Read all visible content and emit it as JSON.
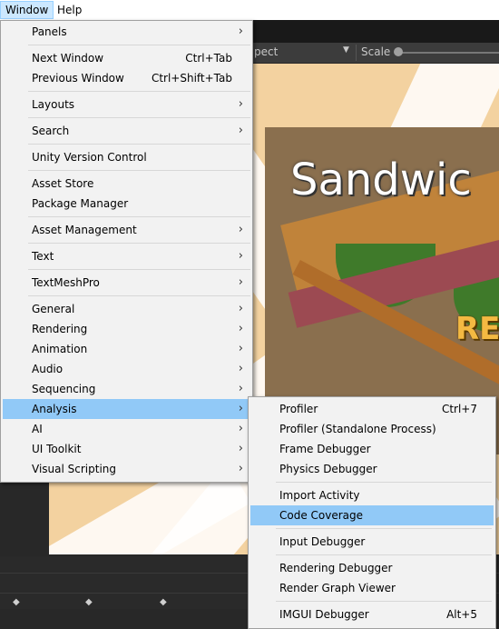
{
  "menubar": {
    "window": "Window",
    "help": "Help"
  },
  "toolbar": {
    "aspect": "pect",
    "scale": "Scale",
    "dropdown_arrow": "▼"
  },
  "game": {
    "title": "Sandwic",
    "badge": "RE"
  },
  "window_menu": [
    {
      "label": "Panels",
      "shortcut": "",
      "submenu": true
    },
    {
      "label": "Next Window",
      "shortcut": "Ctrl+Tab",
      "submenu": false
    },
    {
      "label": "Previous Window",
      "shortcut": "Ctrl+Shift+Tab",
      "submenu": false
    },
    {
      "label": "Layouts",
      "shortcut": "",
      "submenu": true
    },
    {
      "label": "Search",
      "shortcut": "",
      "submenu": true
    },
    {
      "label": "Unity Version Control",
      "shortcut": "",
      "submenu": false
    },
    {
      "label": "Asset Store",
      "shortcut": "",
      "submenu": false
    },
    {
      "label": "Package Manager",
      "shortcut": "",
      "submenu": false
    },
    {
      "label": "Asset Management",
      "shortcut": "",
      "submenu": true
    },
    {
      "label": "Text",
      "shortcut": "",
      "submenu": true
    },
    {
      "label": "TextMeshPro",
      "shortcut": "",
      "submenu": true
    },
    {
      "label": "General",
      "shortcut": "",
      "submenu": true
    },
    {
      "label": "Rendering",
      "shortcut": "",
      "submenu": true
    },
    {
      "label": "Animation",
      "shortcut": "",
      "submenu": true
    },
    {
      "label": "Audio",
      "shortcut": "",
      "submenu": true
    },
    {
      "label": "Sequencing",
      "shortcut": "",
      "submenu": true
    },
    {
      "label": "Analysis",
      "shortcut": "",
      "submenu": true,
      "selected": true
    },
    {
      "label": "AI",
      "shortcut": "",
      "submenu": true
    },
    {
      "label": "UI Toolkit",
      "shortcut": "",
      "submenu": true
    },
    {
      "label": "Visual Scripting",
      "shortcut": "",
      "submenu": true
    }
  ],
  "analysis_menu": [
    {
      "label": "Profiler",
      "shortcut": "Ctrl+7"
    },
    {
      "label": "Profiler (Standalone Process)",
      "shortcut": ""
    },
    {
      "label": "Frame Debugger",
      "shortcut": ""
    },
    {
      "label": "Physics Debugger",
      "shortcut": ""
    },
    {
      "label": "Import Activity",
      "shortcut": ""
    },
    {
      "label": "Code Coverage",
      "shortcut": "",
      "highlighted": true
    },
    {
      "label": "Input Debugger",
      "shortcut": ""
    },
    {
      "label": "Rendering Debugger",
      "shortcut": ""
    },
    {
      "label": "Render Graph Viewer",
      "shortcut": ""
    },
    {
      "label": "IMGUI Debugger",
      "shortcut": "Alt+5"
    }
  ],
  "colors": {
    "selection": "#91c9f7",
    "menu_bg": "#f2f2f2",
    "menubar_active": "#cce8ff"
  },
  "icons": {
    "submenu_arrow": "›"
  }
}
